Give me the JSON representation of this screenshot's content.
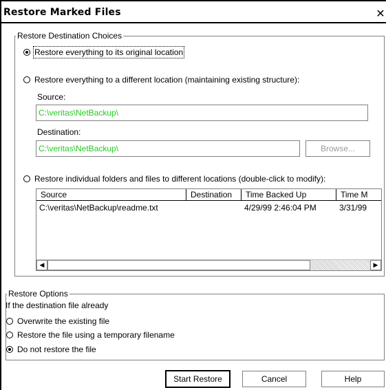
{
  "window": {
    "title": "Restore Marked Files",
    "close_glyph": "✕"
  },
  "destination_group": {
    "legend": "Restore Destination Choices",
    "options": [
      {
        "label": "Restore everything to its original location",
        "checked": true
      },
      {
        "label": "Restore everything to a different location (maintaining existing structure):",
        "checked": false
      },
      {
        "label": "Restore individual folders and files to different locations (double-click to modify):",
        "checked": false
      }
    ],
    "source_label": "Source:",
    "source_value": "C:\\veritas\\NetBackup\\",
    "destination_label": "Destination:",
    "destination_value": "C:\\veritas\\NetBackup\\",
    "browse_label": "Browse..."
  },
  "file_list": {
    "columns": [
      "Source",
      "Destination",
      "Time Backed Up",
      "Time M"
    ],
    "rows": [
      {
        "source": "C:\\veritas\\NetBackup\\readme.txt",
        "destination": "",
        "time_backed_up": "4/29/99 2:46:04 PM",
        "time_modified": "3/31/99"
      }
    ]
  },
  "options_group": {
    "legend": "Restore Options",
    "description": "If the destination file already",
    "options": [
      {
        "label": "Overwrite the existing file",
        "checked": false
      },
      {
        "label": "Restore the file using a temporary filename",
        "checked": false
      },
      {
        "label": "Do not restore the file",
        "checked": true
      }
    ]
  },
  "buttons": {
    "start": "Start Restore",
    "cancel": "Cancel",
    "help": "Help"
  },
  "colors": {
    "path_text": "#22cc22",
    "disabled_text": "#9a9a9a"
  }
}
